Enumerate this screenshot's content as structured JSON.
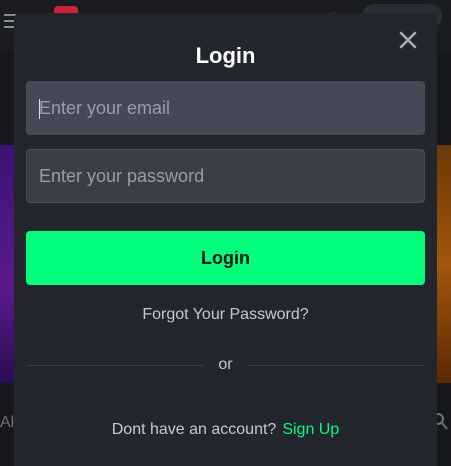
{
  "modal": {
    "title": "Login",
    "close_icon": "close-icon",
    "email_placeholder": "Enter your email",
    "email_value": "",
    "password_placeholder": "Enter your password",
    "password_value": "",
    "login_button": "Login",
    "forgot_password": "Forgot Your Password?",
    "divider": "or",
    "no_account_text": "Dont have an account?",
    "sign_up_link": "Sign Up"
  },
  "background": {
    "left_text": "All",
    "right_icon": "search-icon",
    "menu_icon": "menu-icon"
  },
  "colors": {
    "accent": "#00ff7a",
    "modal_bg": "#23262d",
    "input_bg": "#3b3e48"
  }
}
